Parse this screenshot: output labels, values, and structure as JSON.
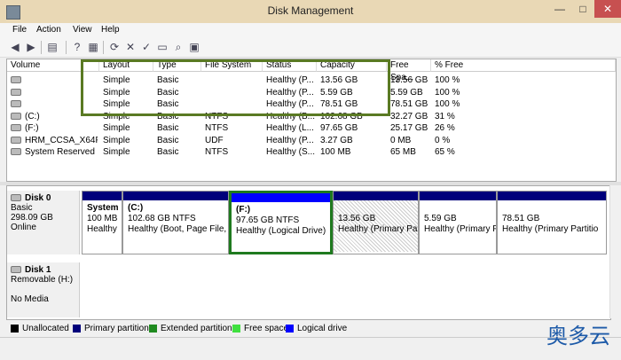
{
  "window": {
    "title": "Disk Management",
    "min": "—",
    "max": "□",
    "close": "✕"
  },
  "menu": [
    {
      "name": "menu-file",
      "label": "File"
    },
    {
      "name": "menu-action",
      "label": "Action"
    },
    {
      "name": "menu-view",
      "label": "View"
    },
    {
      "name": "menu-help",
      "label": "Help"
    }
  ],
  "toolbar": [
    {
      "name": "back-arrow-icon",
      "glyph": "◀"
    },
    {
      "name": "forward-arrow-icon",
      "glyph": "▶"
    },
    {
      "name": "console-tree-icon",
      "glyph": "▤"
    },
    {
      "name": "help-icon",
      "glyph": "?"
    },
    {
      "name": "properties-icon",
      "glyph": "▦"
    },
    {
      "name": "refresh-icon",
      "glyph": "⟳"
    },
    {
      "name": "delete-icon",
      "glyph": "✕"
    },
    {
      "name": "check-icon",
      "glyph": "✓"
    },
    {
      "name": "open-folder-icon",
      "glyph": "▭"
    },
    {
      "name": "search-icon",
      "glyph": "⌕"
    },
    {
      "name": "settings-icon",
      "glyph": "▣"
    }
  ],
  "columns": [
    "Volume",
    "Layout",
    "Type",
    "File System",
    "Status",
    "Capacity",
    "Free Spa...",
    "% Free"
  ],
  "volumes": [
    {
      "volume": "",
      "layout": "Simple",
      "type": "Basic",
      "fs": "",
      "status": "Healthy (P...",
      "capacity": "13.56 GB",
      "free": "13.56 GB",
      "pct": "100 %"
    },
    {
      "volume": "",
      "layout": "Simple",
      "type": "Basic",
      "fs": "",
      "status": "Healthy (P...",
      "capacity": "5.59 GB",
      "free": "5.59 GB",
      "pct": "100 %"
    },
    {
      "volume": "",
      "layout": "Simple",
      "type": "Basic",
      "fs": "",
      "status": "Healthy (P...",
      "capacity": "78.51 GB",
      "free": "78.51 GB",
      "pct": "100 %"
    },
    {
      "volume": "(C:)",
      "layout": "Simple",
      "type": "Basic",
      "fs": "NTFS",
      "status": "Healthy (B...",
      "capacity": "102.68 GB",
      "free": "32.27 GB",
      "pct": "31 %"
    },
    {
      "volume": "(F:)",
      "layout": "Simple",
      "type": "Basic",
      "fs": "NTFS",
      "status": "Healthy (L...",
      "capacity": "97.65 GB",
      "free": "25.17 GB",
      "pct": "26 %"
    },
    {
      "volume": "HRM_CCSA_X64F...",
      "layout": "Simple",
      "type": "Basic",
      "fs": "UDF",
      "status": "Healthy (P...",
      "capacity": "3.27 GB",
      "free": "0 MB",
      "pct": "0 %"
    },
    {
      "volume": "System Reserved (...",
      "layout": "Simple",
      "type": "Basic",
      "fs": "NTFS",
      "status": "Healthy (S...",
      "capacity": "100 MB",
      "free": "65 MB",
      "pct": "65 %"
    }
  ],
  "disk0": {
    "name": "Disk 0",
    "kind": "Basic",
    "size": "298.09 GB",
    "state": "Online",
    "partitions": [
      {
        "name": "part-system-reserved",
        "line1": "System",
        "line2": "100 MB",
        "line3": "Healthy",
        "bar": "#00007b"
      },
      {
        "name": "part-c",
        "line1": "(C:)",
        "line2": "102.68 GB NTFS",
        "line3": "Healthy (Boot, Page File,",
        "bar": "#00007b"
      },
      {
        "name": "part-f",
        "line1": "(F:)",
        "line2": "97.65 GB NTFS",
        "line3": "Healthy (Logical Drive)",
        "bar": "#0000ff"
      },
      {
        "name": "part-1356",
        "line1": "",
        "line2": "13.56 GB",
        "line3": "Healthy (Primary Pa",
        "bar": "#00007b"
      },
      {
        "name": "part-559",
        "line1": "",
        "line2": "5.59 GB",
        "line3": "Healthy (Primary P",
        "bar": "#00007b"
      },
      {
        "name": "part-7851",
        "line1": "",
        "line2": "78.51 GB",
        "line3": "Healthy (Primary Partitio",
        "bar": "#00007b"
      }
    ]
  },
  "disk1": {
    "name": "Disk 1",
    "kind": "Removable (H:)",
    "state": "No Media"
  },
  "legend": [
    {
      "label": "Unallocated",
      "color": "#000000"
    },
    {
      "label": "Primary partition",
      "color": "#00007b"
    },
    {
      "label": "Extended partition",
      "color": "#1f8a1f"
    },
    {
      "label": "Free space",
      "color": "#40e040"
    },
    {
      "label": "Logical drive",
      "color": "#0000ff"
    }
  ],
  "watermark": "奥多云"
}
